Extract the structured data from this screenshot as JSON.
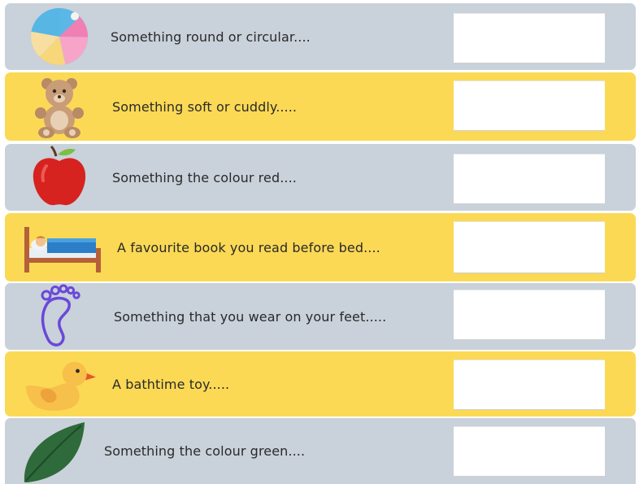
{
  "prompts": [
    {
      "label": "Something round or circular....",
      "icon": "beach-ball-icon",
      "answer": ""
    },
    {
      "label": "Something soft or cuddly.....",
      "icon": "teddy-bear-icon",
      "answer": ""
    },
    {
      "label": "Something the colour red....",
      "icon": "red-apple-icon",
      "answer": ""
    },
    {
      "label": "A favourite book you read before bed....",
      "icon": "bed-icon",
      "answer": ""
    },
    {
      "label": "Something that you wear on your feet.....",
      "icon": "footprint-icon",
      "answer": ""
    },
    {
      "label": "A bathtime toy.....",
      "icon": "rubber-duck-icon",
      "answer": ""
    },
    {
      "label": "Something the colour green....",
      "icon": "green-leaf-icon",
      "answer": ""
    }
  ],
  "colors": {
    "grey_row": "#c9d1da",
    "yellow_row": "#fbd955",
    "answer_box": "#ffffff"
  }
}
